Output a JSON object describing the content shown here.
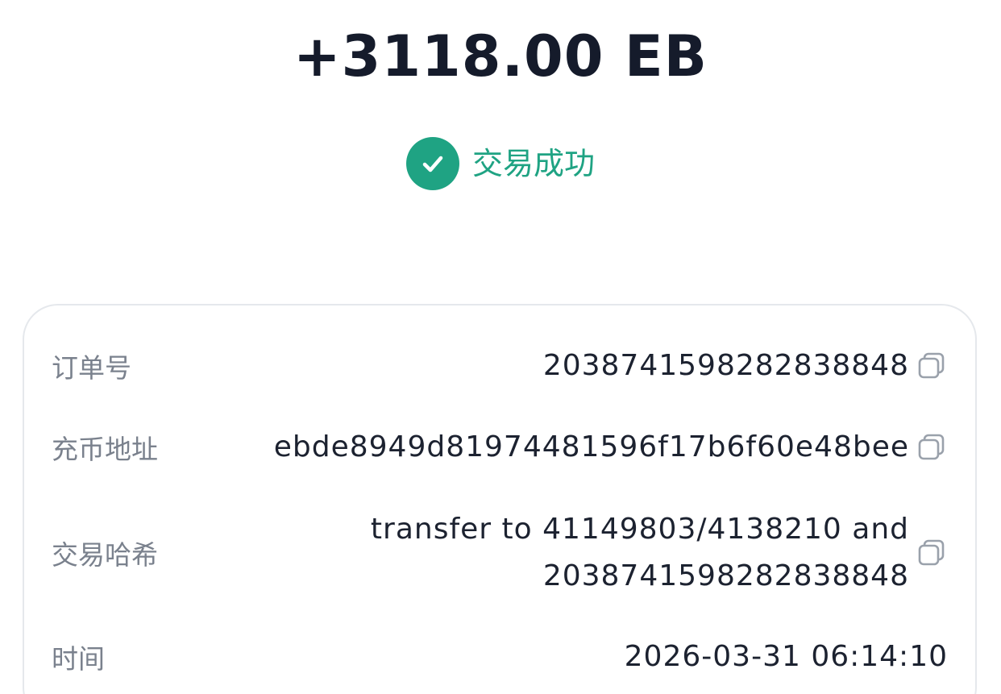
{
  "header": {
    "amount": "+3118.00 EB"
  },
  "status": {
    "icon": "check-circle-icon",
    "text": "交易成功",
    "color": "#1fa383"
  },
  "details": {
    "order_no": {
      "label": "订单号",
      "value": "2038741598282838848",
      "icon": "copy-icon"
    },
    "deposit_address": {
      "label": "充币地址",
      "value": "ebde8949d81974481596f17b6f60e48bee",
      "icon": "copy-icon"
    },
    "tx_hash": {
      "label": "交易哈希",
      "value_line1": "transfer to 41149803/4138210 and",
      "value_line2": "2038741598282838848",
      "icon": "copy-icon"
    },
    "time": {
      "label": "时间",
      "value": "2026-03-31 06:14:10"
    }
  }
}
